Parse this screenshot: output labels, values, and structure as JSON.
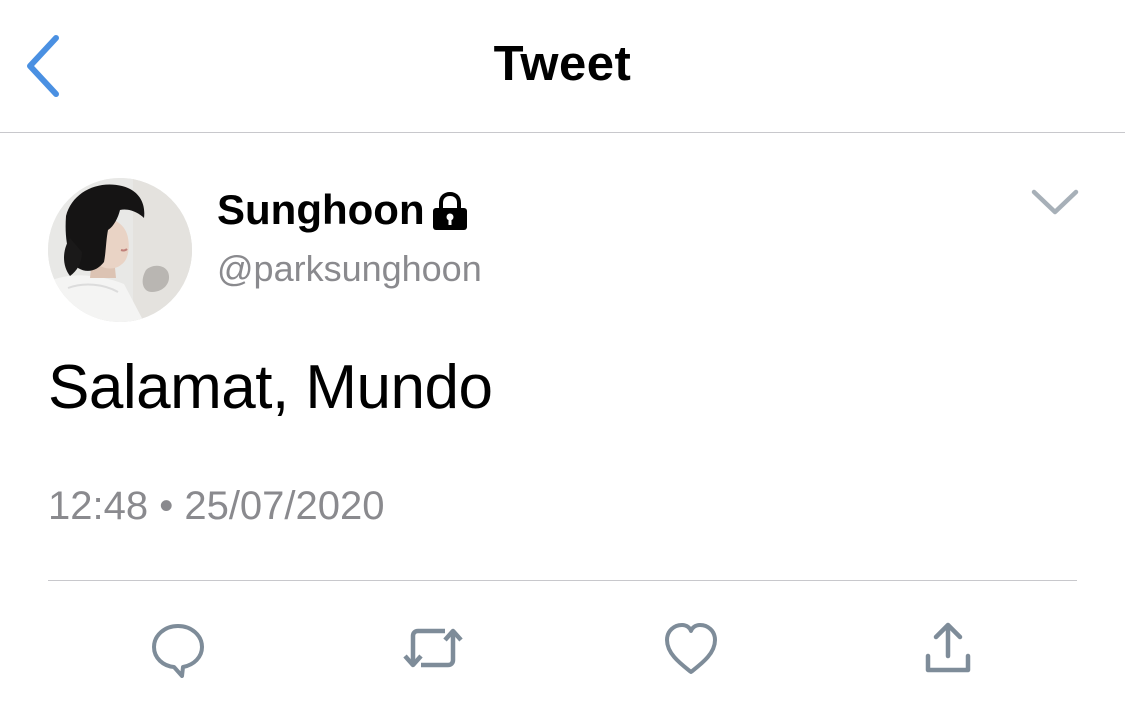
{
  "header": {
    "title": "Tweet",
    "back_icon": "chevron-left-icon"
  },
  "tweet": {
    "display_name": "Sunghoon",
    "handle": "@parksunghoon",
    "protected": true,
    "text": "Salamat, Mundo",
    "timestamp": "12:48 • 25/07/2020"
  },
  "actions": [
    {
      "name": "reply",
      "icon": "reply-icon"
    },
    {
      "name": "retweet",
      "icon": "retweet-icon"
    },
    {
      "name": "like",
      "icon": "heart-icon"
    },
    {
      "name": "share",
      "icon": "share-icon"
    }
  ],
  "colors": {
    "accent": "#4a90e2",
    "secondary_text": "#8a8a8e",
    "icon_gray": "#7e8c99",
    "divider": "#c8c8cc"
  }
}
